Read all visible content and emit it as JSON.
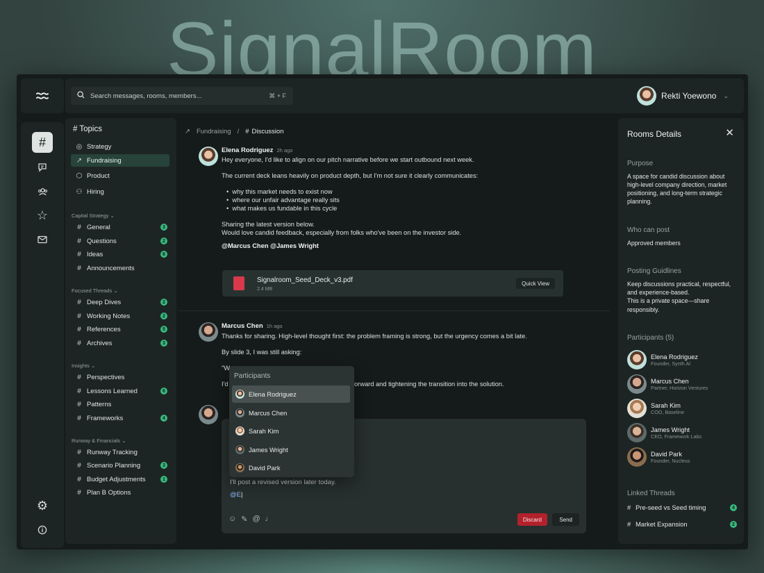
{
  "brand": "SignalRoom",
  "search": {
    "placeholder": "Search messages, rooms, members...",
    "shortcut": "⌘ + F"
  },
  "user": {
    "name": "Rekti Yoewono"
  },
  "sidebar": {
    "title": "# Topics",
    "topics": [
      {
        "label": "Strategy"
      },
      {
        "label": "Fundraising"
      },
      {
        "label": "Product"
      },
      {
        "label": "Hiring"
      }
    ],
    "groups": [
      {
        "label": "Capital Strategy",
        "items": [
          {
            "label": "General",
            "badge": "3"
          },
          {
            "label": "Questions",
            "badge": "2"
          },
          {
            "label": "Ideas",
            "badge": "6"
          },
          {
            "label": "Announcements",
            "badge": ""
          }
        ]
      },
      {
        "label": "Focused Threads",
        "items": [
          {
            "label": "Deep Dives",
            "badge": "2"
          },
          {
            "label": "Working Notes",
            "badge": "2"
          },
          {
            "label": "References",
            "badge": "5"
          },
          {
            "label": "Archives",
            "badge": "3"
          }
        ]
      },
      {
        "label": "Insights",
        "items": [
          {
            "label": "Perspectives",
            "badge": ""
          },
          {
            "label": "Lessons Learned",
            "badge": "6"
          },
          {
            "label": "Patterns",
            "badge": ""
          },
          {
            "label": "Frameworks",
            "badge": "4"
          }
        ]
      },
      {
        "label": "Runway & Financials",
        "items": [
          {
            "label": "Runway Tracking",
            "badge": ""
          },
          {
            "label": "Scenario Planning",
            "badge": "3"
          },
          {
            "label": "Budget Adjustments",
            "badge": "1"
          },
          {
            "label": "Plan B Options",
            "badge": ""
          }
        ]
      }
    ]
  },
  "breadcrumb": {
    "parent": "Fundraising",
    "separator": "/",
    "current": "Discussion"
  },
  "messages": {
    "m1": {
      "author": "Elena Rodriguez",
      "time": "2h ago",
      "lines": [
        "Hey everyone, I'd like to align on our pitch narrative before we start outbound next week.",
        "The current deck leans heavily on product depth, but I'm not sure it clearly communicates:"
      ],
      "bullets": [
        "why this market needs to exist now",
        "where our unfair advantage really sits",
        "what makes us fundable in this cycle"
      ],
      "closing": [
        "Sharing the latest version below.",
        "Would love candid feedback, especially from folks who've been on the investor side."
      ],
      "mentions": "@Marcus Chen @James Wright",
      "attachment": {
        "name": "Signalroom_Seed_Deck_v3.pdf",
        "size": "2.4 MB",
        "action": "Quick View"
      }
    },
    "m2": {
      "author": "Marcus Chen",
      "time": "1h ago",
      "line1": "Thanks for sharing. High-level thought first: the problem framing is strong, but the urgency comes a bit late.",
      "line2": "By slide 3, I was still asking:",
      "line3": "\"W",
      "line4a": "I'd",
      "line4b": "orward and tightening the transition into the solution."
    }
  },
  "composer": {
    "text": "I'll post a revised version later today.",
    "input": "@E",
    "discard": "Discard",
    "send": "Send"
  },
  "mention_popup": {
    "title": "Participants",
    "items": [
      "Elena Rodriguez",
      "Marcus Chen",
      "Sarah Kim",
      "James Wright",
      "David Park"
    ]
  },
  "details": {
    "title": "Rooms Details",
    "purpose_h": "Purpose",
    "purpose": [
      "A space for candid discussion about",
      "high-level company direction, market",
      "positioning, and long-term strategic",
      "planning."
    ],
    "who_h": "Who can post",
    "who": "Approved members",
    "guide_h": "Posting Guidlines",
    "guide": [
      "Keep discussions practical, respectful,",
      "and experience-based.",
      "This is a private space—share",
      "responsibly."
    ],
    "participants_h": "Participants (5)",
    "participants": [
      {
        "name": "Elena Rodriguez",
        "role": "Founder, Synth AI"
      },
      {
        "name": "Marcus Chen",
        "role": "Partner, Horizon Ventures"
      },
      {
        "name": "Sarah Kim",
        "role": "COO, Baseline"
      },
      {
        "name": "James Wright",
        "role": "CEO, Framework Labs"
      },
      {
        "name": "David Park",
        "role": "Founder, Nucleus"
      }
    ],
    "linked_h": "Linked Threads",
    "linked": [
      {
        "label": "Pre-seed vs Seed timing",
        "badge": "4"
      },
      {
        "label": "Market Expansion",
        "badge": "2"
      }
    ]
  },
  "colors": {
    "accent": "#39b97f",
    "danger": "#b2212c",
    "bg": "#151b1a",
    "panel": "#1d2524"
  }
}
